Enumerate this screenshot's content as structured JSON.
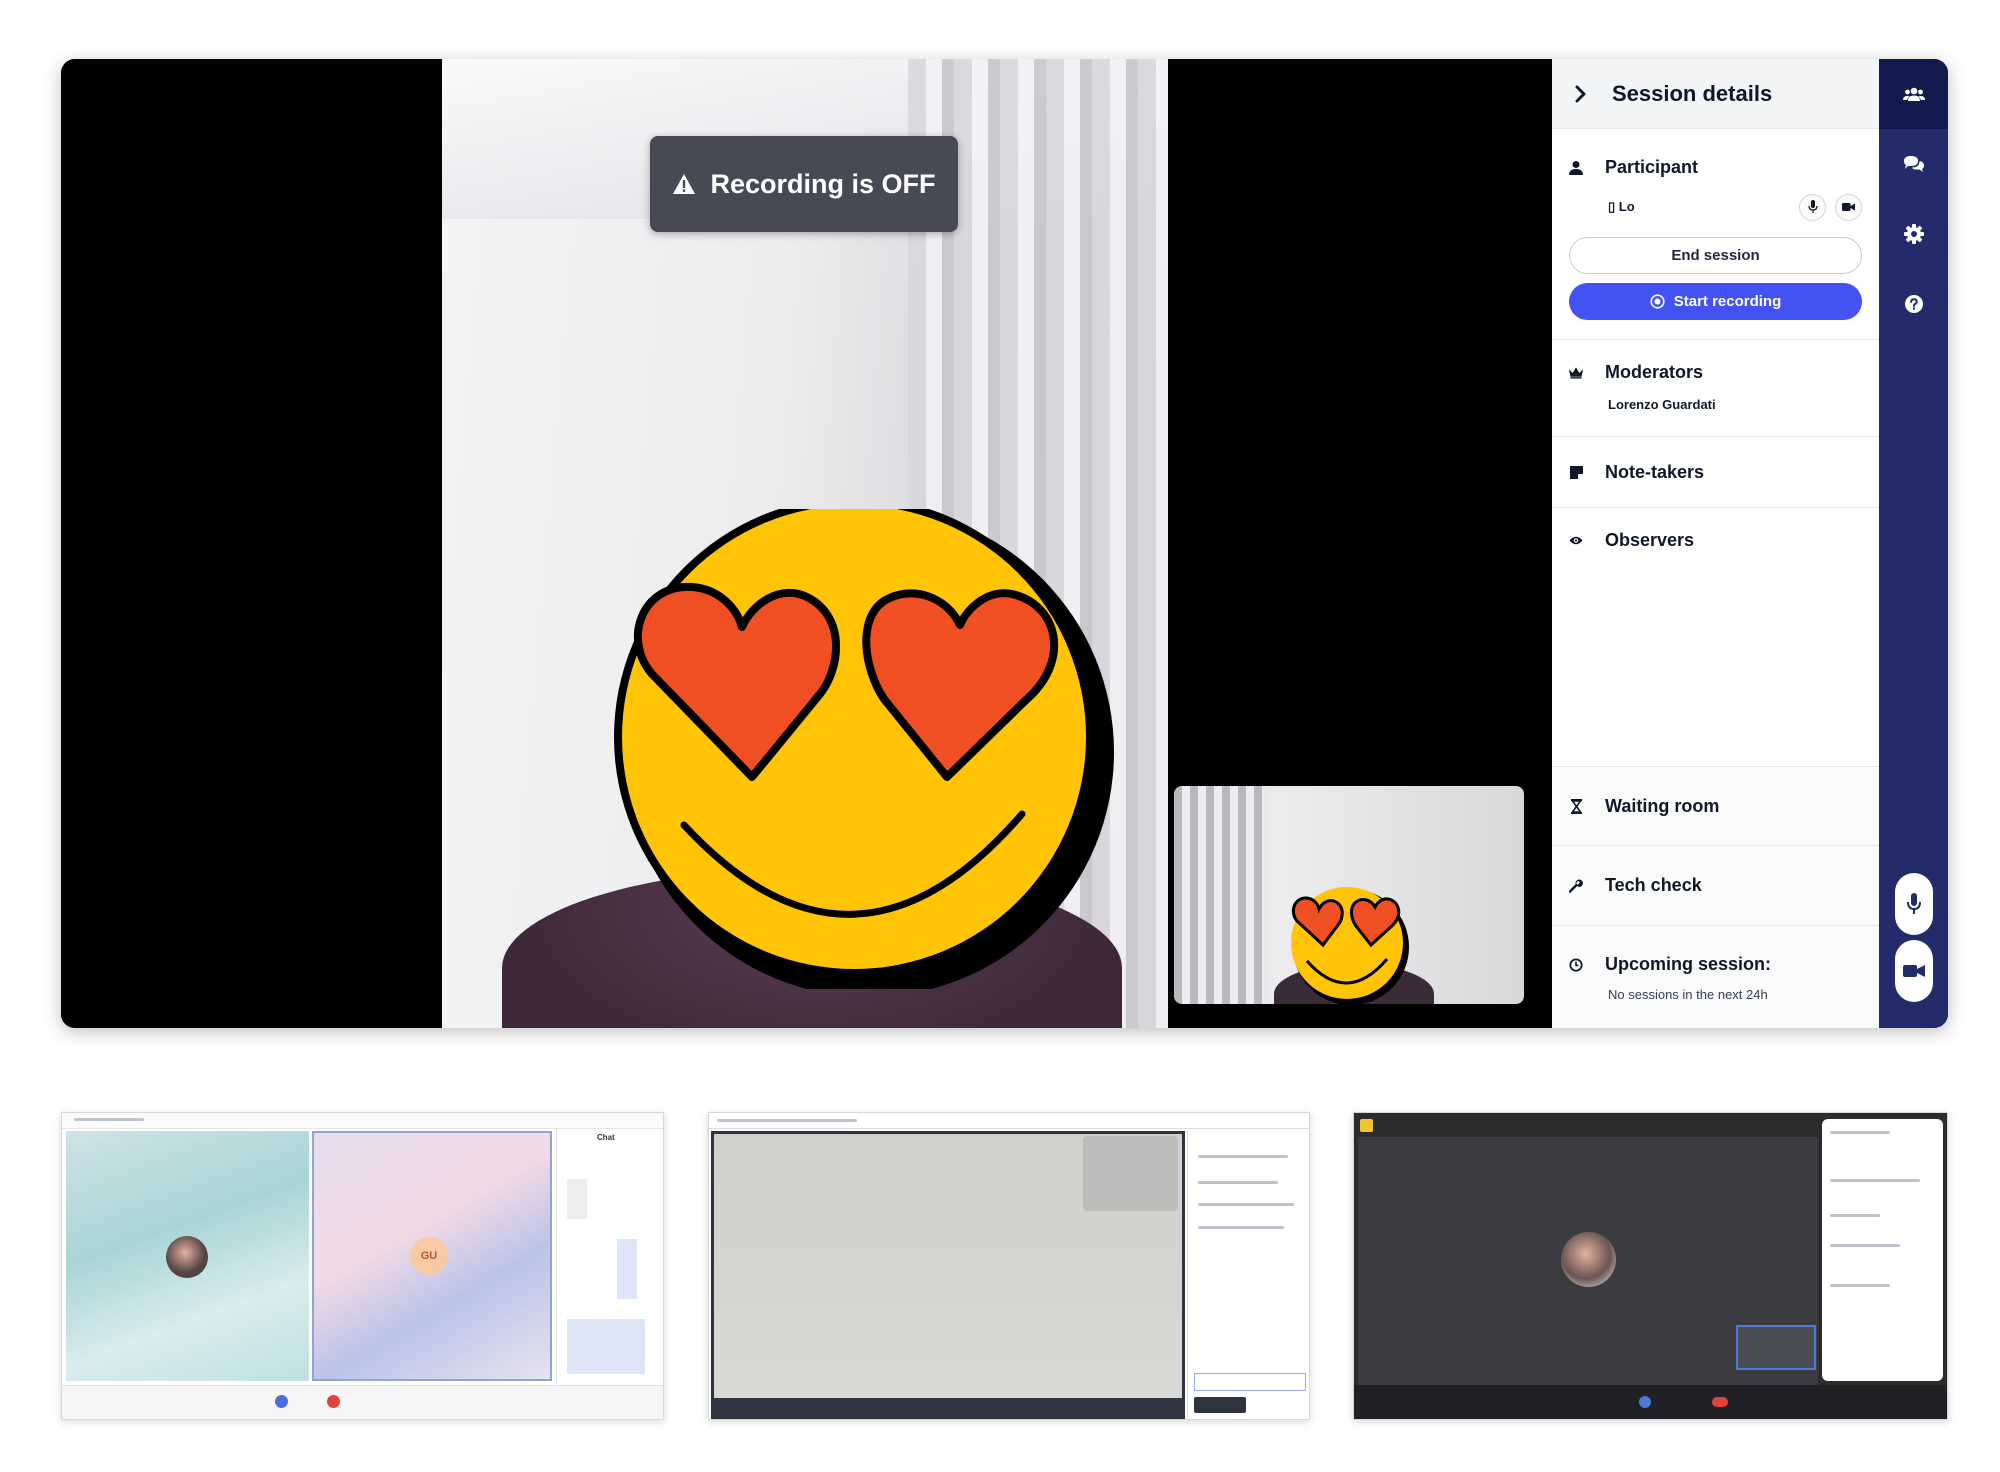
{
  "colors": {
    "accent": "#4353f2",
    "rail": "#232b6b",
    "banner": "#474a55",
    "emoji_face": "#ffc406",
    "emoji_hearts": "#f04e23"
  },
  "banner": {
    "icon": "warning-icon",
    "text": "Recording is OFF"
  },
  "session_panel": {
    "title": "Session details",
    "participant": {
      "title": "Participant",
      "name": "▯ Lo",
      "end_session": "End session",
      "start_recording": "Start recording"
    },
    "moderators": {
      "title": "Moderators",
      "name": "Lorenzo Guardati"
    },
    "note_takers": {
      "title": "Note-takers"
    },
    "observers": {
      "title": "Observers"
    },
    "waiting_room": {
      "title": "Waiting room"
    },
    "tech_check": {
      "title": "Tech check"
    },
    "upcoming": {
      "title": "Upcoming session:",
      "note": "No sessions in the next 24h"
    }
  },
  "right_rail": {
    "items": [
      "participants-icon",
      "chat-icon",
      "gear-icon",
      "help-icon"
    ],
    "media": [
      "microphone-icon",
      "camera-icon"
    ]
  },
  "thumbnails": {
    "teams": {
      "chat_title": "Chat",
      "avatar_initials": "GU"
    }
  }
}
